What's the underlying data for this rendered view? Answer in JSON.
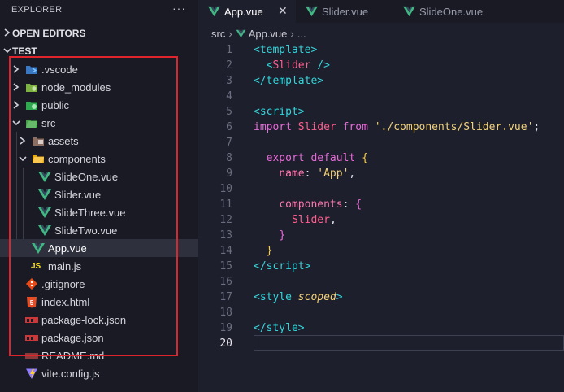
{
  "sidebar": {
    "title": "EXPLORER",
    "more": "···",
    "open_editors": "OPEN EDITORS",
    "project": "TEST",
    "tree": [
      {
        "label": ".vscode",
        "icon": "vscode-folder-icon"
      },
      {
        "label": "node_modules",
        "icon": "node-folder-icon"
      },
      {
        "label": "public",
        "icon": "public-folder-icon"
      },
      {
        "label": "src",
        "icon": "src-folder-icon"
      },
      {
        "label": "assets",
        "icon": "assets-folder-icon"
      },
      {
        "label": "components",
        "icon": "components-folder-icon"
      },
      {
        "label": "SlideOne.vue",
        "icon": "vue-icon"
      },
      {
        "label": "Slider.vue",
        "icon": "vue-icon"
      },
      {
        "label": "SlideThree.vue",
        "icon": "vue-icon"
      },
      {
        "label": "SlideTwo.vue",
        "icon": "vue-icon"
      },
      {
        "label": "App.vue",
        "icon": "vue-icon"
      },
      {
        "label": "main.js",
        "icon": "js-icon"
      },
      {
        "label": ".gitignore",
        "icon": "git-icon"
      },
      {
        "label": "index.html",
        "icon": "html-icon"
      },
      {
        "label": "package-lock.json",
        "icon": "npm-icon"
      },
      {
        "label": "package.json",
        "icon": "npm-icon"
      },
      {
        "label": "README.md",
        "icon": "readme-icon"
      },
      {
        "label": "vite.config.js",
        "icon": "vite-icon"
      }
    ]
  },
  "tabs": [
    {
      "label": "App.vue",
      "close": "✕"
    },
    {
      "label": "Slider.vue"
    },
    {
      "label": "SlideOne.vue"
    }
  ],
  "breadcrumb": {
    "folder": "src",
    "file": "App.vue",
    "more": "..."
  },
  "code": {
    "line_numbers": [
      "1",
      "2",
      "3",
      "4",
      "5",
      "6",
      "7",
      "8",
      "9",
      "10",
      "11",
      "12",
      "13",
      "14",
      "15",
      "16",
      "17",
      "18",
      "19",
      "20"
    ],
    "l1": {
      "open": "<",
      "tag": "template",
      "close": ">"
    },
    "l2": {
      "open": "<",
      "comp": "Slider",
      "close": " />"
    },
    "l3": {
      "open": "</",
      "tag": "template",
      "close": ">"
    },
    "l5": {
      "open": "<",
      "tag": "script",
      "close": ">"
    },
    "l6": {
      "kw1": "import",
      "id": "Slider",
      "kw2": "from",
      "str": "'./components/Slider.vue'",
      "semi": ";"
    },
    "l8": {
      "kw1": "export",
      "kw2": "default",
      "brace": "{"
    },
    "l9": {
      "prop": "name",
      "colon": ": ",
      "str": "'App'",
      "comma": ","
    },
    "l11": {
      "prop": "components",
      "colon": ": ",
      "brace": "{"
    },
    "l12": {
      "id": "Slider",
      "comma": ","
    },
    "l13": {
      "brace": "}"
    },
    "l14": {
      "brace": "}"
    },
    "l15": {
      "open": "</",
      "tag": "script",
      "close": ">"
    },
    "l17": {
      "open": "<",
      "tag": "style",
      "attr": "scoped",
      "close": ">"
    },
    "l19": {
      "open": "</",
      "tag": "style",
      "close": ">"
    }
  },
  "colors": {
    "highlight_border": "#e0242b",
    "vue_green": "#41b883",
    "background": "#1e1f2c"
  }
}
